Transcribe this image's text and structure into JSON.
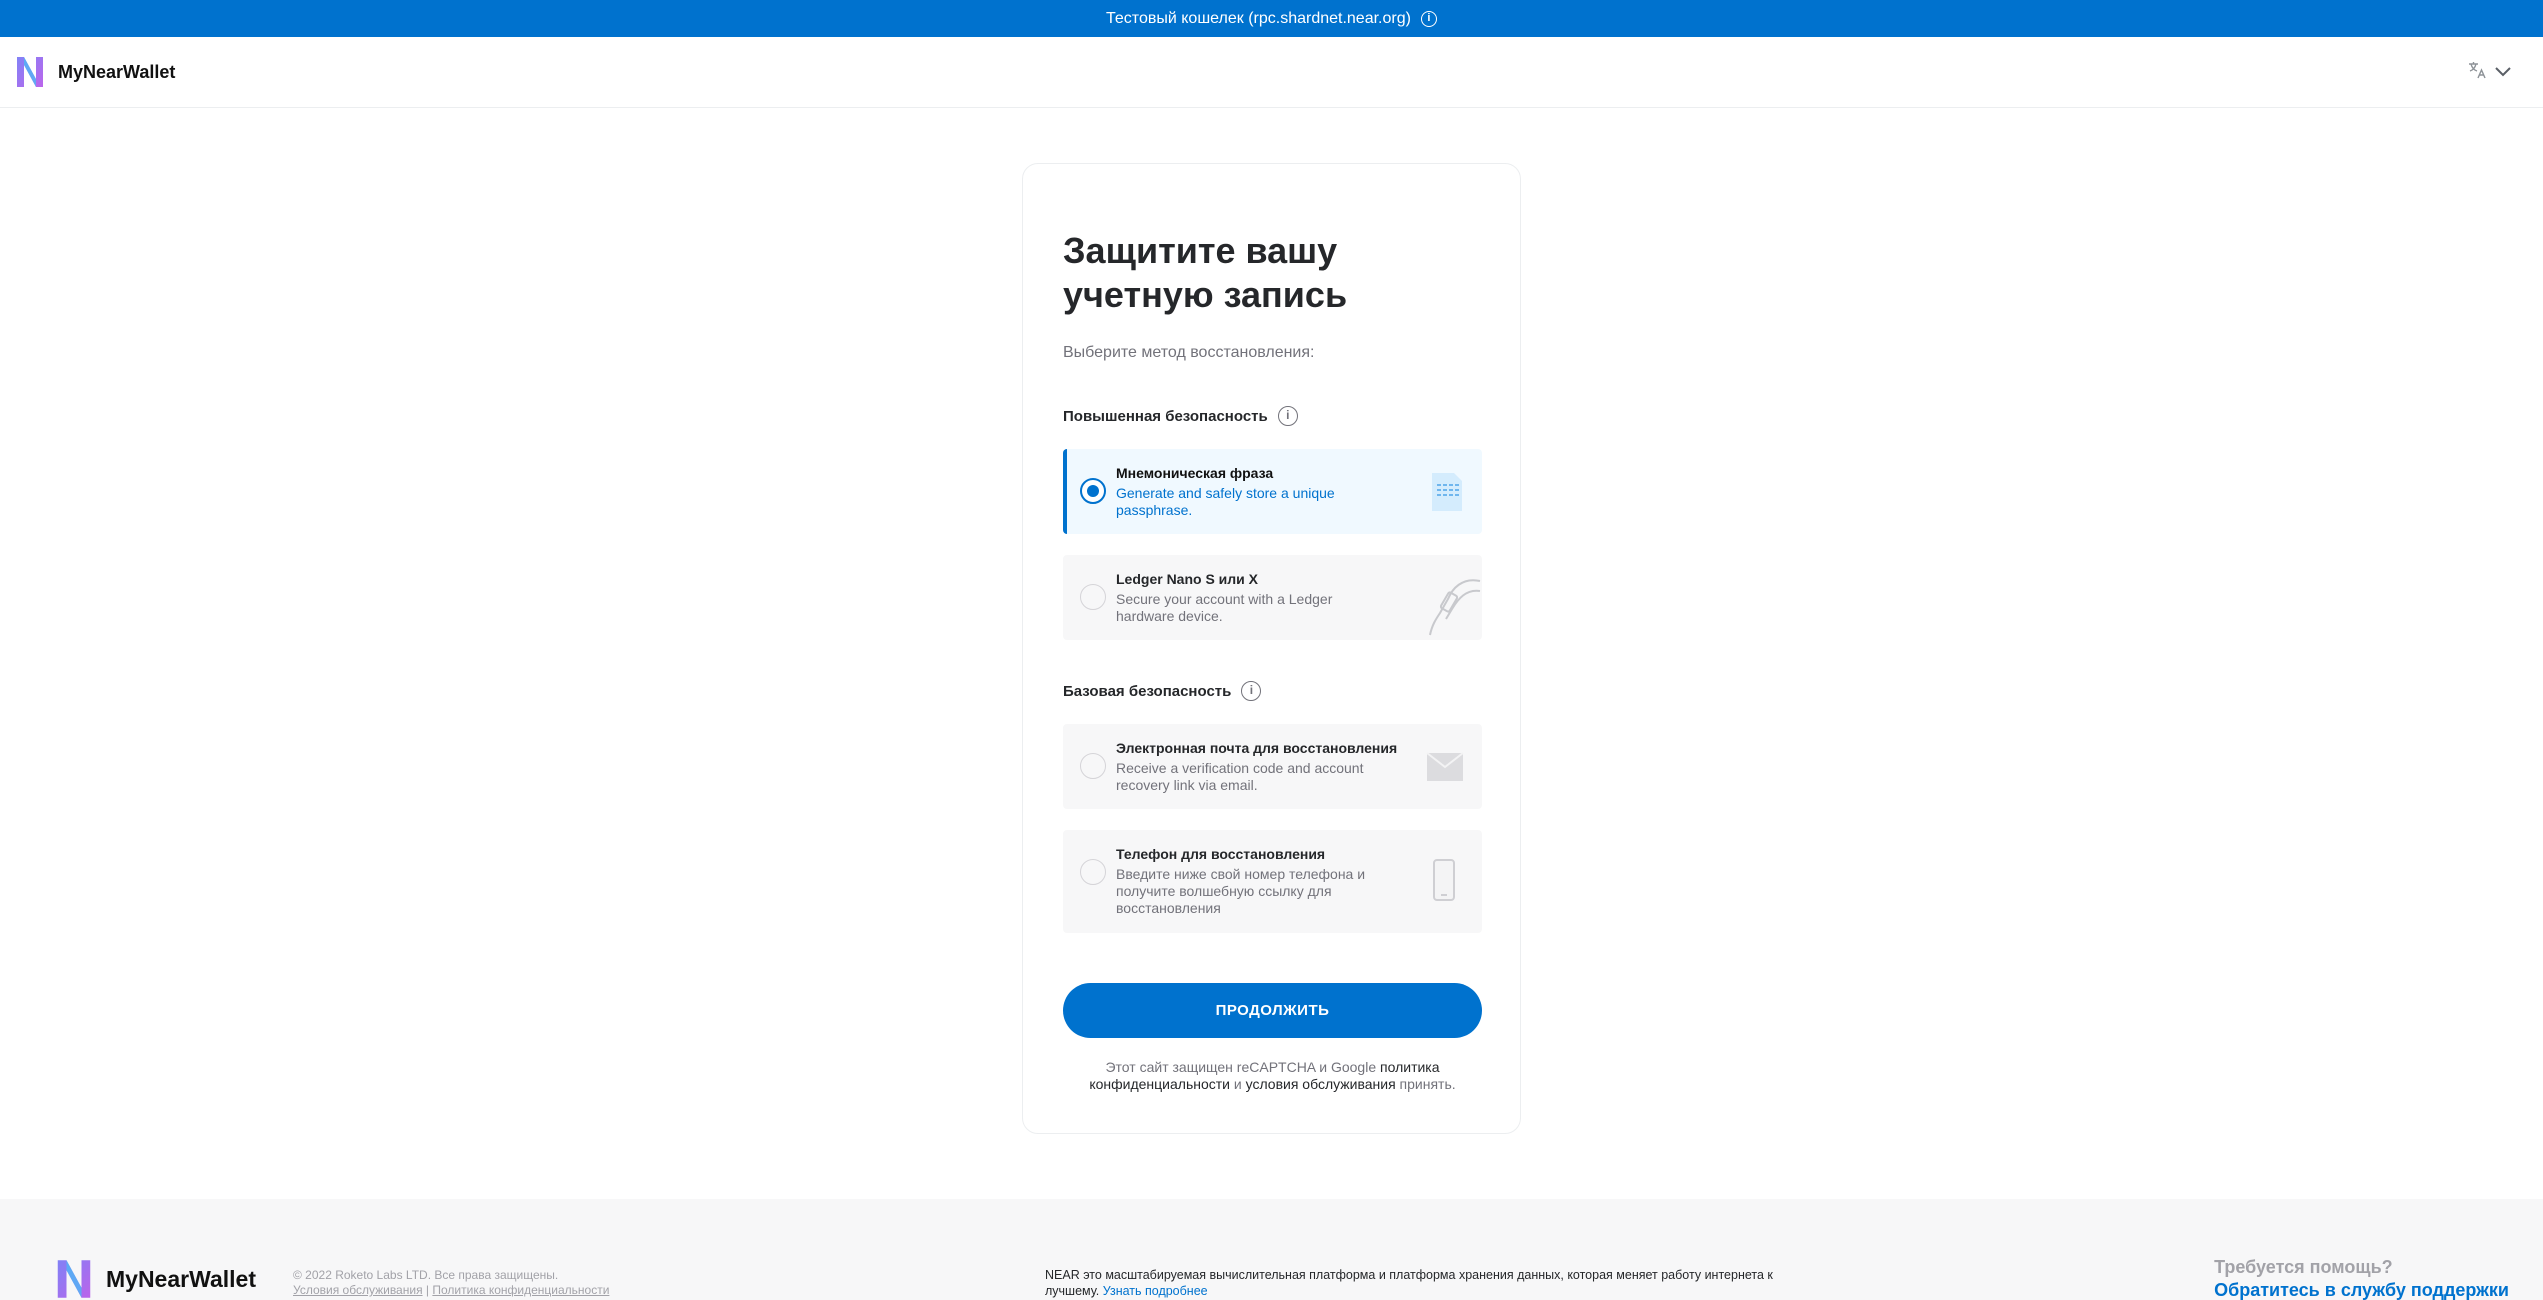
{
  "banner": {
    "text": "Тестовый кошелек (rpc.shardnet.near.org)",
    "info_icon": "info-icon"
  },
  "header": {
    "brand": "MyNearWallet",
    "language_icon": "translate-icon",
    "dropdown_icon": "chevron-down-icon"
  },
  "page": {
    "title": "Защитите вашу учетную запись",
    "subtitle": "Выберите метод восстановления:",
    "section_advanced": "Повышенная безопасность",
    "section_basic": "Базовая безопасность",
    "options": [
      {
        "title": "Мнемоническая фраза",
        "desc": "Generate and safely store a unique passphrase.",
        "selected": true,
        "icon": "document-grid-icon"
      },
      {
        "title": "Ledger Nano S или X",
        "desc": "Secure your account with a Ledger hardware device.",
        "selected": false,
        "icon": "ledger-device-icon"
      },
      {
        "title": "Электронная почта для восстановления",
        "desc": "Receive a verification code and account recovery link via email.",
        "selected": false,
        "icon": "envelope-icon"
      },
      {
        "title": "Телефон для восстановления",
        "desc": "Введите ниже свой номер телефона и получите волшебную ссылку для восстановления",
        "selected": false,
        "icon": "phone-icon"
      }
    ],
    "continue_label": "ПРОДОЛЖИТЬ",
    "recaptcha": {
      "prefix": "Этот сайт защищен reCAPTCHA и Google ",
      "privacy": "политика конфиденциальности",
      "and": " и ",
      "terms": "условия обслуживания",
      "suffix": " принять."
    }
  },
  "footer": {
    "brand": "MyNearWallet",
    "copyright": "© 2022 Roketo Labs LTD. Все права защищены.",
    "terms": "Условия обслуживания",
    "separator": "|",
    "privacy": "Политика конфиденциальности",
    "about": "NEAR это масштабируемая вычислительная платформа и платформа хранения данных, которая меняет работу интернета к лучшему.",
    "learn_more": "Узнать подробнее",
    "help_question": "Требуется помощь?",
    "help_link": "Обратитесь в службу поддержки"
  },
  "colors": {
    "brand": "#0072ce",
    "selected_bg": "#f0f9ff",
    "option_bg": "#f7f7f8"
  }
}
